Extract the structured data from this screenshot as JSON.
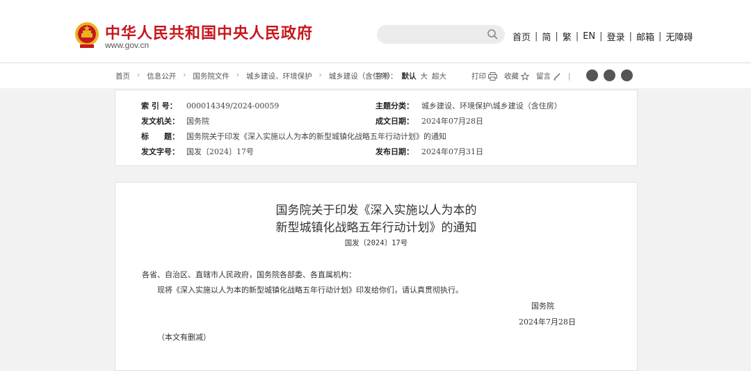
{
  "site": {
    "title": "中华人民共和国中央人民政府",
    "url": "www.gov.cn"
  },
  "search": {
    "placeholder": ""
  },
  "topnav": [
    "首页",
    "简",
    "繁",
    "EN",
    "登录",
    "邮箱",
    "无障碍"
  ],
  "breadcrumb": [
    "首页",
    "信息公开",
    "国务院文件",
    "城乡建设、环境保护",
    "城乡建设（含住房）"
  ],
  "fontsize": {
    "label": "字号：",
    "options": [
      "默认",
      "大",
      "超大"
    ]
  },
  "tools": {
    "print": "打印",
    "favorite": "收藏",
    "comment": "留言"
  },
  "info": {
    "index_label": "索 引 号：",
    "index_value": "000014349/2024-00059",
    "category_label": "主题分类：",
    "category_value": "城乡建设、环境保护\\城乡建设（含住房）",
    "issuer_label": "发文机关：",
    "issuer_value": "国务院",
    "created_label": "成文日期：",
    "created_value": "2024年07月28日",
    "title_label": "标　　题：",
    "title_value": "国务院关于印发《深入实施以人为本的新型城镇化战略五年行动计划》的通知",
    "docno_label": "发文字号：",
    "docno_value": "国发〔2024〕17号",
    "published_label": "发布日期：",
    "published_value": "2024年07月31日"
  },
  "doc": {
    "title_line1": "国务院关于印发《深入实施以人为本的",
    "title_line2": "新型城镇化战略五年行动计划》的通知",
    "number": "国发〔2024〕17号",
    "addressee": "各省、自治区、直辖市人民政府，国务院各部委、各直属机构：",
    "body": "现将《深入实施以人为本的新型城镇化战略五年行动计划》印发给你们，请认真贯彻执行。",
    "signer": "国务院",
    "date": "2024年7月28日",
    "note": "（本文有删减）"
  },
  "colors": {
    "brand_red": "#c8161e",
    "emblem_gold": "#e6b422",
    "background": "#f2f2f2"
  }
}
